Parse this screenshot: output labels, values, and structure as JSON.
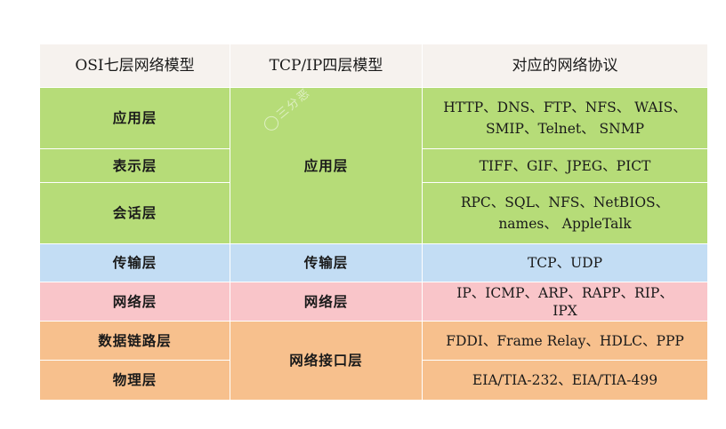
{
  "table": {
    "headers": [
      "OSI七层网络模型",
      "TCP/IP四层模型",
      "对应的网络协议"
    ],
    "rows": [
      {
        "osi": "应用层",
        "tcp": "应用层",
        "protocols": [
          "HTTP、DNS、FTP、NFS、 WAIS、",
          "SMIP、Telnet、 SNMP"
        ]
      },
      {
        "osi": "表示层",
        "tcp": "",
        "protocols": [
          "TIFF、GIF、JPEG、PICT"
        ]
      },
      {
        "osi": "会话层",
        "tcp": "",
        "protocols": [
          "RPC、SQL、NFS、NetBIOS、",
          "names、 AppleTalk"
        ]
      },
      {
        "osi": "传输层",
        "tcp": "传输层",
        "protocols": [
          "TCP、UDP"
        ]
      },
      {
        "osi": "网络层",
        "tcp": "网络层",
        "protocols": [
          "IP、ICMP、ARP、RAPP、RIP、",
          "IPX"
        ]
      },
      {
        "osi": "数据链路层",
        "tcp": "网络接口层",
        "protocols": [
          "FDDI、Frame Relay、HDLC、PPP"
        ]
      },
      {
        "osi": "物理层",
        "tcp": "",
        "protocols": [
          "EIA/TIA-232、EIA/TIA-499"
        ]
      }
    ]
  },
  "watermark": {
    "text": "三分恶",
    "icon": "wechat-logo-icon"
  },
  "colors": {
    "header": "#f6f2ee",
    "application": "#b6dc78",
    "transport": "#c3ddf4",
    "network": "#f9c5c9",
    "link": "#f7c08d"
  }
}
